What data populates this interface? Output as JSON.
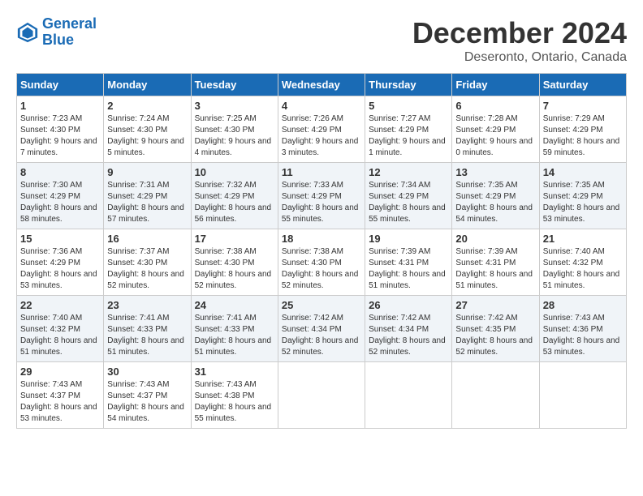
{
  "logo": {
    "line1": "General",
    "line2": "Blue"
  },
  "title": "December 2024",
  "subtitle": "Deseronto, Ontario, Canada",
  "weekdays": [
    "Sunday",
    "Monday",
    "Tuesday",
    "Wednesday",
    "Thursday",
    "Friday",
    "Saturday"
  ],
  "weeks": [
    [
      {
        "day": "1",
        "sunrise": "7:23 AM",
        "sunset": "4:30 PM",
        "daylight": "9 hours and 7 minutes."
      },
      {
        "day": "2",
        "sunrise": "7:24 AM",
        "sunset": "4:30 PM",
        "daylight": "9 hours and 5 minutes."
      },
      {
        "day": "3",
        "sunrise": "7:25 AM",
        "sunset": "4:30 PM",
        "daylight": "9 hours and 4 minutes."
      },
      {
        "day": "4",
        "sunrise": "7:26 AM",
        "sunset": "4:29 PM",
        "daylight": "9 hours and 3 minutes."
      },
      {
        "day": "5",
        "sunrise": "7:27 AM",
        "sunset": "4:29 PM",
        "daylight": "9 hours and 1 minute."
      },
      {
        "day": "6",
        "sunrise": "7:28 AM",
        "sunset": "4:29 PM",
        "daylight": "9 hours and 0 minutes."
      },
      {
        "day": "7",
        "sunrise": "7:29 AM",
        "sunset": "4:29 PM",
        "daylight": "8 hours and 59 minutes."
      }
    ],
    [
      {
        "day": "8",
        "sunrise": "7:30 AM",
        "sunset": "4:29 PM",
        "daylight": "8 hours and 58 minutes."
      },
      {
        "day": "9",
        "sunrise": "7:31 AM",
        "sunset": "4:29 PM",
        "daylight": "8 hours and 57 minutes."
      },
      {
        "day": "10",
        "sunrise": "7:32 AM",
        "sunset": "4:29 PM",
        "daylight": "8 hours and 56 minutes."
      },
      {
        "day": "11",
        "sunrise": "7:33 AM",
        "sunset": "4:29 PM",
        "daylight": "8 hours and 55 minutes."
      },
      {
        "day": "12",
        "sunrise": "7:34 AM",
        "sunset": "4:29 PM",
        "daylight": "8 hours and 55 minutes."
      },
      {
        "day": "13",
        "sunrise": "7:35 AM",
        "sunset": "4:29 PM",
        "daylight": "8 hours and 54 minutes."
      },
      {
        "day": "14",
        "sunrise": "7:35 AM",
        "sunset": "4:29 PM",
        "daylight": "8 hours and 53 minutes."
      }
    ],
    [
      {
        "day": "15",
        "sunrise": "7:36 AM",
        "sunset": "4:29 PM",
        "daylight": "8 hours and 53 minutes."
      },
      {
        "day": "16",
        "sunrise": "7:37 AM",
        "sunset": "4:30 PM",
        "daylight": "8 hours and 52 minutes."
      },
      {
        "day": "17",
        "sunrise": "7:38 AM",
        "sunset": "4:30 PM",
        "daylight": "8 hours and 52 minutes."
      },
      {
        "day": "18",
        "sunrise": "7:38 AM",
        "sunset": "4:30 PM",
        "daylight": "8 hours and 52 minutes."
      },
      {
        "day": "19",
        "sunrise": "7:39 AM",
        "sunset": "4:31 PM",
        "daylight": "8 hours and 51 minutes."
      },
      {
        "day": "20",
        "sunrise": "7:39 AM",
        "sunset": "4:31 PM",
        "daylight": "8 hours and 51 minutes."
      },
      {
        "day": "21",
        "sunrise": "7:40 AM",
        "sunset": "4:32 PM",
        "daylight": "8 hours and 51 minutes."
      }
    ],
    [
      {
        "day": "22",
        "sunrise": "7:40 AM",
        "sunset": "4:32 PM",
        "daylight": "8 hours and 51 minutes."
      },
      {
        "day": "23",
        "sunrise": "7:41 AM",
        "sunset": "4:33 PM",
        "daylight": "8 hours and 51 minutes."
      },
      {
        "day": "24",
        "sunrise": "7:41 AM",
        "sunset": "4:33 PM",
        "daylight": "8 hours and 51 minutes."
      },
      {
        "day": "25",
        "sunrise": "7:42 AM",
        "sunset": "4:34 PM",
        "daylight": "8 hours and 52 minutes."
      },
      {
        "day": "26",
        "sunrise": "7:42 AM",
        "sunset": "4:34 PM",
        "daylight": "8 hours and 52 minutes."
      },
      {
        "day": "27",
        "sunrise": "7:42 AM",
        "sunset": "4:35 PM",
        "daylight": "8 hours and 52 minutes."
      },
      {
        "day": "28",
        "sunrise": "7:43 AM",
        "sunset": "4:36 PM",
        "daylight": "8 hours and 53 minutes."
      }
    ],
    [
      {
        "day": "29",
        "sunrise": "7:43 AM",
        "sunset": "4:37 PM",
        "daylight": "8 hours and 53 minutes."
      },
      {
        "day": "30",
        "sunrise": "7:43 AM",
        "sunset": "4:37 PM",
        "daylight": "8 hours and 54 minutes."
      },
      {
        "day": "31",
        "sunrise": "7:43 AM",
        "sunset": "4:38 PM",
        "daylight": "8 hours and 55 minutes."
      },
      null,
      null,
      null,
      null
    ]
  ]
}
